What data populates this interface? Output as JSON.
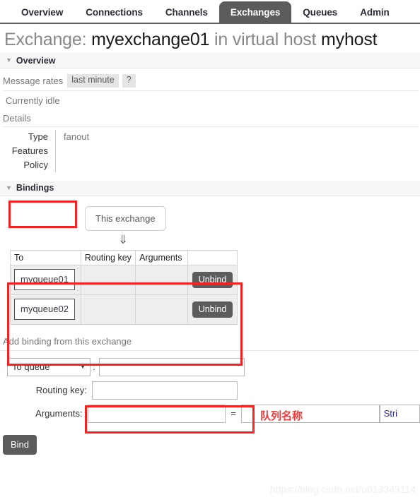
{
  "nav": {
    "tabs": [
      {
        "label": "Overview",
        "active": false
      },
      {
        "label": "Connections",
        "active": false
      },
      {
        "label": "Channels",
        "active": false
      },
      {
        "label": "Exchanges",
        "active": true
      },
      {
        "label": "Queues",
        "active": false
      },
      {
        "label": "Admin",
        "active": false
      }
    ]
  },
  "title": {
    "prefix": "Exchange:",
    "exchange_name": "myexchange01",
    "middle": "in virtual host",
    "vhost": "myhost"
  },
  "overview": {
    "section_label": "Overview",
    "caret": "caret-down-icon",
    "message_rates_label": "Message rates",
    "rate_period_button": "last minute",
    "help_button": "?",
    "currently_idle": "Currently idle",
    "details_label": "Details",
    "details": [
      {
        "key": "Type",
        "value": "fanout"
      },
      {
        "key": "Features",
        "value": ""
      },
      {
        "key": "Policy",
        "value": ""
      }
    ]
  },
  "bindings": {
    "section_label": "Bindings",
    "this_exchange_label": "This exchange",
    "arrow_glyph": "⇓",
    "columns": [
      "To",
      "Routing key",
      "Arguments",
      ""
    ],
    "rows": [
      {
        "to": "myqueue01",
        "routing_key": "",
        "arguments": "",
        "action": "Unbind"
      },
      {
        "to": "myqueue02",
        "routing_key": "",
        "arguments": "",
        "action": "Unbind"
      }
    ]
  },
  "add_binding": {
    "heading": "Add binding from this exchange",
    "destination_select": "To queue",
    "destination_colon": ":",
    "destination_value": "",
    "routing_key_label": "Routing key:",
    "routing_key_value": "",
    "arguments_label": "Arguments:",
    "arguments_key_value": "",
    "equals": "=",
    "arguments_val_value": "",
    "type_select": "Stri",
    "bind_button": "Bind"
  },
  "annotations": {
    "queue_name_note": "队列名称",
    "box_color": "#f52222"
  },
  "watermark": "https://blog.csdn.net/u013343114"
}
